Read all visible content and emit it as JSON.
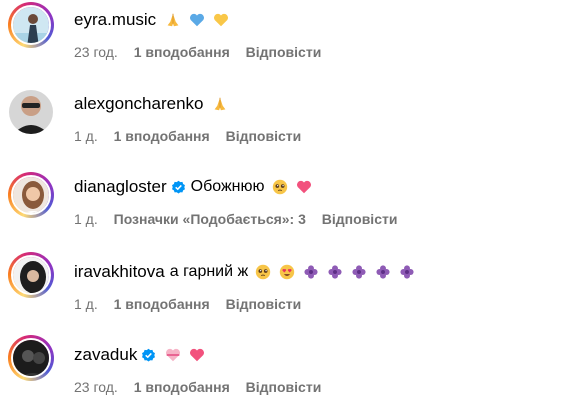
{
  "comments": [
    {
      "username": "eyra.music",
      "verified": false,
      "text": "",
      "emojis": [
        "folded-hands-icon",
        "blue-heart-icon",
        "yellow-heart-icon"
      ],
      "time": "23 год.",
      "likes": "1 вподобання",
      "reply": "Відповісти"
    },
    {
      "username": "alexgoncharenko",
      "verified": false,
      "text": "",
      "emojis": [
        "folded-hands-icon"
      ],
      "time": "1 д.",
      "likes": "1 вподобання",
      "reply": "Відповісти"
    },
    {
      "username": "dianagloster",
      "verified": true,
      "text": "Обожнюю",
      "emojis": [
        "pleading-face-icon",
        "pink-heart-icon"
      ],
      "time": "1 д.",
      "likes": "Позначки «Подобається»: 3",
      "reply": "Відповісти"
    },
    {
      "username": "iravakhitova",
      "verified": false,
      "text": "а гарний ж",
      "emojis": [
        "pleading-face-icon",
        "heart-eyes-icon",
        "purple-flower-icon",
        "purple-flower-icon",
        "purple-flower-icon",
        "purple-flower-icon",
        "purple-flower-icon"
      ],
      "time": "1 д.",
      "likes": "1 вподобання",
      "reply": "Відповісти"
    },
    {
      "username": "zavaduk",
      "verified": true,
      "text": "",
      "emojis": [
        "heart-with-ribbon-icon",
        "pink-heart-icon"
      ],
      "time": "23 год.",
      "likes": "1 вподобання",
      "reply": "Відповісти"
    }
  ],
  "colors": {
    "secondary_text": "#737373",
    "verified_blue": "#0095f6"
  }
}
